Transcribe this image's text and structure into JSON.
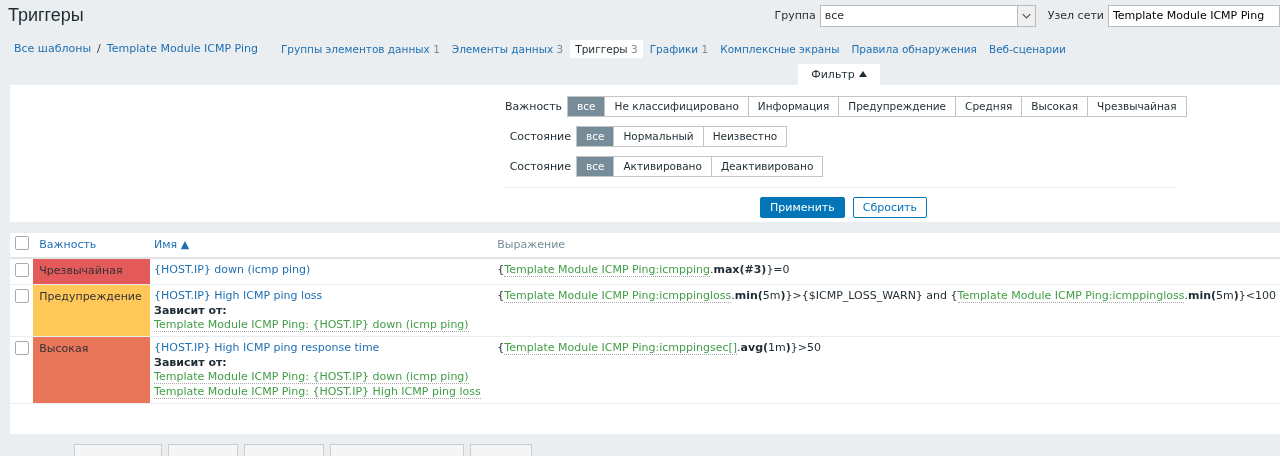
{
  "header": {
    "title": "Триггеры",
    "group_label": "Группа",
    "group_value": "все",
    "host_label": "Узел сети",
    "host_value": "Template Module ICMP Ping"
  },
  "breadcrumb_separator": "/",
  "breadcrumbs": [
    {
      "label": "Все шаблоны"
    },
    {
      "label": "Template Module ICMP Ping"
    }
  ],
  "nav_tabs": [
    {
      "label": "Группы элементов данных",
      "count": "1",
      "selected": false
    },
    {
      "label": "Элементы данных",
      "count": "3",
      "selected": false
    },
    {
      "label": "Триггеры",
      "count": "3",
      "selected": true
    },
    {
      "label": "Графики",
      "count": "1",
      "selected": false
    },
    {
      "label": "Комплексные экраны",
      "selected": false
    },
    {
      "label": "Правила обнаружения",
      "selected": false
    },
    {
      "label": "Веб-сценарии",
      "selected": false
    }
  ],
  "filter": {
    "tab_label": "Фильтр",
    "expanded": true,
    "rows": [
      {
        "label": "Важность",
        "options": [
          {
            "label": "все",
            "selected": true
          },
          {
            "label": "Не классифицировано",
            "selected": false
          },
          {
            "label": "Информация",
            "selected": false
          },
          {
            "label": "Предупреждение",
            "selected": false
          },
          {
            "label": "Средняя",
            "selected": false
          },
          {
            "label": "Высокая",
            "selected": false
          },
          {
            "label": "Чрезвычайная",
            "selected": false
          }
        ]
      },
      {
        "label": "Состояние",
        "options": [
          {
            "label": "все",
            "selected": true
          },
          {
            "label": "Нормальный",
            "selected": false
          },
          {
            "label": "Неизвестно",
            "selected": false
          }
        ]
      },
      {
        "label": "Состояние",
        "options": [
          {
            "label": "все",
            "selected": true
          },
          {
            "label": "Активировано",
            "selected": false
          },
          {
            "label": "Деактивировано",
            "selected": false
          }
        ]
      }
    ],
    "apply_button": "Применить",
    "reset_button": "Сбросить"
  },
  "table": {
    "select_all_checked": false,
    "columns": [
      {
        "label": "Важность",
        "kind": "link"
      },
      {
        "label": "Имя ▲",
        "kind": "link"
      },
      {
        "label": "Выражение",
        "kind": "plain"
      }
    ],
    "rows": [
      {
        "checked": false,
        "severity": "Чрезвычайная",
        "color": "#e45959",
        "name": "{HOST.IP} down (icmp ping)",
        "depends_label": "",
        "depends": [],
        "expression": [
          {
            "kind": "text",
            "text": "{"
          },
          {
            "kind": "link",
            "text": "Template Module ICMP Ping:icmpping"
          },
          {
            "kind": "text",
            "text": ".**max(#3)**}=0"
          }
        ]
      },
      {
        "checked": false,
        "severity": "Предупреждение",
        "color": "#ffc859",
        "name": "{HOST.IP} High ICMP ping loss",
        "depends_label": "Зависит от:",
        "depends": [
          "Template Module ICMP Ping: {HOST.IP} down (icmp ping)"
        ],
        "expression": [
          {
            "kind": "text",
            "text": "{"
          },
          {
            "kind": "link",
            "text": "Template Module ICMP Ping:icmppingloss"
          },
          {
            "kind": "text",
            "text": ".**min(**5m**)**}>{$ICMP_LOSS_WARN} and {"
          },
          {
            "kind": "link",
            "text": "Template Module ICMP Ping:icmppingloss"
          },
          {
            "kind": "text",
            "text": ".**min(**5m**)**}<100"
          }
        ]
      },
      {
        "checked": false,
        "severity": "Высокая",
        "color": "#e97659",
        "name": "{HOST.IP} High ICMP ping response time",
        "depends_label": "Зависит от:",
        "depends": [
          "Template Module ICMP Ping: {HOST.IP} down (icmp ping)",
          "Template Module ICMP Ping: {HOST.IP} High ICMP ping loss"
        ],
        "expression": [
          {
            "kind": "text",
            "text": "{"
          },
          {
            "kind": "link",
            "text": "Template Module ICMP Ping:icmppingsec[]"
          },
          {
            "kind": "text",
            "text": ".**avg(**1m**)**}>50"
          }
        ]
      }
    ]
  }
}
